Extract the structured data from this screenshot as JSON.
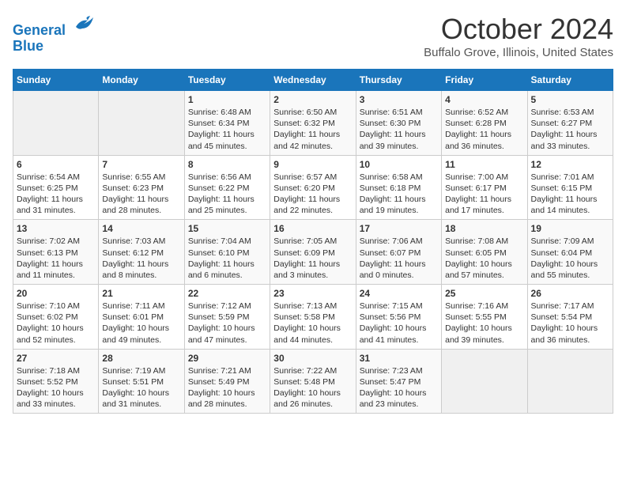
{
  "header": {
    "logo_line1": "General",
    "logo_line2": "Blue",
    "month": "October 2024",
    "location": "Buffalo Grove, Illinois, United States"
  },
  "days_of_week": [
    "Sunday",
    "Monday",
    "Tuesday",
    "Wednesday",
    "Thursday",
    "Friday",
    "Saturday"
  ],
  "weeks": [
    [
      {
        "num": "",
        "info": ""
      },
      {
        "num": "",
        "info": ""
      },
      {
        "num": "1",
        "info": "Sunrise: 6:48 AM\nSunset: 6:34 PM\nDaylight: 11 hours and 45 minutes."
      },
      {
        "num": "2",
        "info": "Sunrise: 6:50 AM\nSunset: 6:32 PM\nDaylight: 11 hours and 42 minutes."
      },
      {
        "num": "3",
        "info": "Sunrise: 6:51 AM\nSunset: 6:30 PM\nDaylight: 11 hours and 39 minutes."
      },
      {
        "num": "4",
        "info": "Sunrise: 6:52 AM\nSunset: 6:28 PM\nDaylight: 11 hours and 36 minutes."
      },
      {
        "num": "5",
        "info": "Sunrise: 6:53 AM\nSunset: 6:27 PM\nDaylight: 11 hours and 33 minutes."
      }
    ],
    [
      {
        "num": "6",
        "info": "Sunrise: 6:54 AM\nSunset: 6:25 PM\nDaylight: 11 hours and 31 minutes."
      },
      {
        "num": "7",
        "info": "Sunrise: 6:55 AM\nSunset: 6:23 PM\nDaylight: 11 hours and 28 minutes."
      },
      {
        "num": "8",
        "info": "Sunrise: 6:56 AM\nSunset: 6:22 PM\nDaylight: 11 hours and 25 minutes."
      },
      {
        "num": "9",
        "info": "Sunrise: 6:57 AM\nSunset: 6:20 PM\nDaylight: 11 hours and 22 minutes."
      },
      {
        "num": "10",
        "info": "Sunrise: 6:58 AM\nSunset: 6:18 PM\nDaylight: 11 hours and 19 minutes."
      },
      {
        "num": "11",
        "info": "Sunrise: 7:00 AM\nSunset: 6:17 PM\nDaylight: 11 hours and 17 minutes."
      },
      {
        "num": "12",
        "info": "Sunrise: 7:01 AM\nSunset: 6:15 PM\nDaylight: 11 hours and 14 minutes."
      }
    ],
    [
      {
        "num": "13",
        "info": "Sunrise: 7:02 AM\nSunset: 6:13 PM\nDaylight: 11 hours and 11 minutes."
      },
      {
        "num": "14",
        "info": "Sunrise: 7:03 AM\nSunset: 6:12 PM\nDaylight: 11 hours and 8 minutes."
      },
      {
        "num": "15",
        "info": "Sunrise: 7:04 AM\nSunset: 6:10 PM\nDaylight: 11 hours and 6 minutes."
      },
      {
        "num": "16",
        "info": "Sunrise: 7:05 AM\nSunset: 6:09 PM\nDaylight: 11 hours and 3 minutes."
      },
      {
        "num": "17",
        "info": "Sunrise: 7:06 AM\nSunset: 6:07 PM\nDaylight: 11 hours and 0 minutes."
      },
      {
        "num": "18",
        "info": "Sunrise: 7:08 AM\nSunset: 6:05 PM\nDaylight: 10 hours and 57 minutes."
      },
      {
        "num": "19",
        "info": "Sunrise: 7:09 AM\nSunset: 6:04 PM\nDaylight: 10 hours and 55 minutes."
      }
    ],
    [
      {
        "num": "20",
        "info": "Sunrise: 7:10 AM\nSunset: 6:02 PM\nDaylight: 10 hours and 52 minutes."
      },
      {
        "num": "21",
        "info": "Sunrise: 7:11 AM\nSunset: 6:01 PM\nDaylight: 10 hours and 49 minutes."
      },
      {
        "num": "22",
        "info": "Sunrise: 7:12 AM\nSunset: 5:59 PM\nDaylight: 10 hours and 47 minutes."
      },
      {
        "num": "23",
        "info": "Sunrise: 7:13 AM\nSunset: 5:58 PM\nDaylight: 10 hours and 44 minutes."
      },
      {
        "num": "24",
        "info": "Sunrise: 7:15 AM\nSunset: 5:56 PM\nDaylight: 10 hours and 41 minutes."
      },
      {
        "num": "25",
        "info": "Sunrise: 7:16 AM\nSunset: 5:55 PM\nDaylight: 10 hours and 39 minutes."
      },
      {
        "num": "26",
        "info": "Sunrise: 7:17 AM\nSunset: 5:54 PM\nDaylight: 10 hours and 36 minutes."
      }
    ],
    [
      {
        "num": "27",
        "info": "Sunrise: 7:18 AM\nSunset: 5:52 PM\nDaylight: 10 hours and 33 minutes."
      },
      {
        "num": "28",
        "info": "Sunrise: 7:19 AM\nSunset: 5:51 PM\nDaylight: 10 hours and 31 minutes."
      },
      {
        "num": "29",
        "info": "Sunrise: 7:21 AM\nSunset: 5:49 PM\nDaylight: 10 hours and 28 minutes."
      },
      {
        "num": "30",
        "info": "Sunrise: 7:22 AM\nSunset: 5:48 PM\nDaylight: 10 hours and 26 minutes."
      },
      {
        "num": "31",
        "info": "Sunrise: 7:23 AM\nSunset: 5:47 PM\nDaylight: 10 hours and 23 minutes."
      },
      {
        "num": "",
        "info": ""
      },
      {
        "num": "",
        "info": ""
      }
    ]
  ]
}
